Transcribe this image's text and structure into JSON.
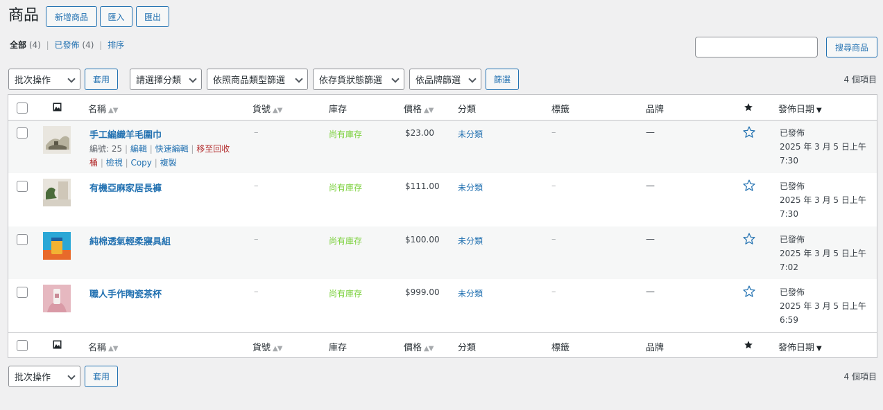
{
  "page": {
    "title": "商品",
    "buttons": {
      "add": "新增商品",
      "import": "匯入",
      "export": "匯出"
    }
  },
  "views": {
    "all_label": "全部",
    "all_count": "(4)",
    "sep": "|",
    "published_label": "已發佈",
    "published_count": "(4)",
    "sorting_label": "排序"
  },
  "search": {
    "button": "搜尋商品",
    "value": ""
  },
  "filters": {
    "bulk_action": "批次操作",
    "apply": "套用",
    "category": "請選擇分類",
    "product_type": "依照商品類型篩選",
    "stock_status": "依存貨狀態篩選",
    "brand": "依品牌篩選",
    "filter_button": "篩選"
  },
  "items_count": "4 個項目",
  "columns": {
    "name": "名稱",
    "sku": "貨號",
    "stock": "庫存",
    "price": "價格",
    "category": "分類",
    "tags": "標籤",
    "brand": "品牌",
    "date": "發佈日期",
    "sort_icon": "▲▼",
    "sort_desc_icon": "▼"
  },
  "row_actions": {
    "id_label": "編號: 25",
    "edit": "編輯",
    "quick_edit": "快速編輯",
    "trash_1": "移至回收",
    "trash_2": "桶",
    "view": "檢視",
    "copy": "Copy",
    "duplicate": "複製",
    "sep": "|"
  },
  "products": [
    {
      "name": "手工編織羊毛圍巾",
      "sku": "–",
      "stock": "尚有庫存",
      "price": "$23.00",
      "category": "未分類",
      "tags": "–",
      "brand": "—",
      "status": "已發佈",
      "date": "2025 年 3 月 5 日上午",
      "time": "7:30",
      "thumb_colors": [
        "#e9e6df",
        "#5a5646",
        "#b7b29e"
      ]
    },
    {
      "name": "有機亞麻家居長褲",
      "sku": "–",
      "stock": "尚有庫存",
      "price": "$111.00",
      "category": "未分類",
      "tags": "–",
      "brand": "—",
      "status": "已發佈",
      "date": "2025 年 3 月 5 日上午",
      "time": "7:30",
      "thumb_colors": [
        "#e8e4dc",
        "#4a6b3a",
        "#cfc7b8"
      ]
    },
    {
      "name": "純棉透氣輕柔寢具組",
      "sku": "–",
      "stock": "尚有庫存",
      "price": "$100.00",
      "category": "未分類",
      "tags": "–",
      "brand": "—",
      "status": "已發佈",
      "date": "2025 年 3 月 5 日上午",
      "time": "7:02",
      "thumb_colors": [
        "#2aa7d6",
        "#e86a2a",
        "#f2b233"
      ]
    },
    {
      "name": "職人手作陶瓷茶杯",
      "sku": "–",
      "stock": "尚有庫存",
      "price": "$999.00",
      "category": "未分類",
      "tags": "–",
      "brand": "—",
      "status": "已發佈",
      "date": "2025 年 3 月 5 日上午",
      "time": "6:59",
      "thumb_colors": [
        "#e6b8c0",
        "#d99aa6",
        "#f4f0ee"
      ]
    }
  ],
  "colors": {
    "accent": "#2271b1",
    "in_stock": "#7ad03a",
    "trash": "#b32d2e"
  }
}
